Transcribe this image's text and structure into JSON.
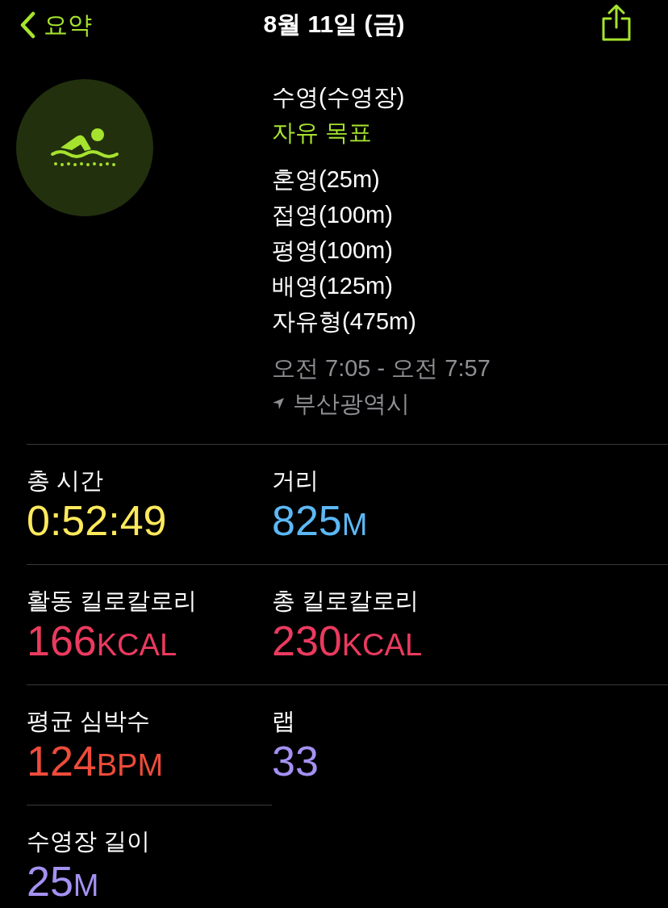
{
  "header": {
    "back_label": "요약",
    "title": "8월 11일 (금)"
  },
  "workout": {
    "name": "수영(수영장)",
    "goal": "자유 목표",
    "strokes": [
      "혼영(25m)",
      "접영(100m)",
      "평영(100m)",
      "배영(125m)",
      "자유형(475m)"
    ],
    "time_range": "오전 7:05 - 오전 7:57",
    "location": "부산광역시"
  },
  "metrics": [
    {
      "label": "총 시간",
      "value": "0:52:49",
      "color": "#fde95c"
    },
    {
      "label": "거리",
      "value": "825",
      "unit": "M",
      "color": "#5cb8f5"
    },
    {
      "label": "활동 킬로칼로리",
      "value": "166",
      "unit": "KCAL",
      "color": "#eb3a5f"
    },
    {
      "label": "총 킬로칼로리",
      "value": "230",
      "unit": "KCAL",
      "color": "#eb3a5f"
    },
    {
      "label": "평균 심박수",
      "value": "124",
      "unit": "BPM",
      "color": "#ee4b3a"
    },
    {
      "label": "랩",
      "value": "33",
      "color": "#a591f2"
    },
    {
      "label": "수영장 길이",
      "value": "25",
      "unit": "M",
      "color": "#a591f2"
    }
  ]
}
